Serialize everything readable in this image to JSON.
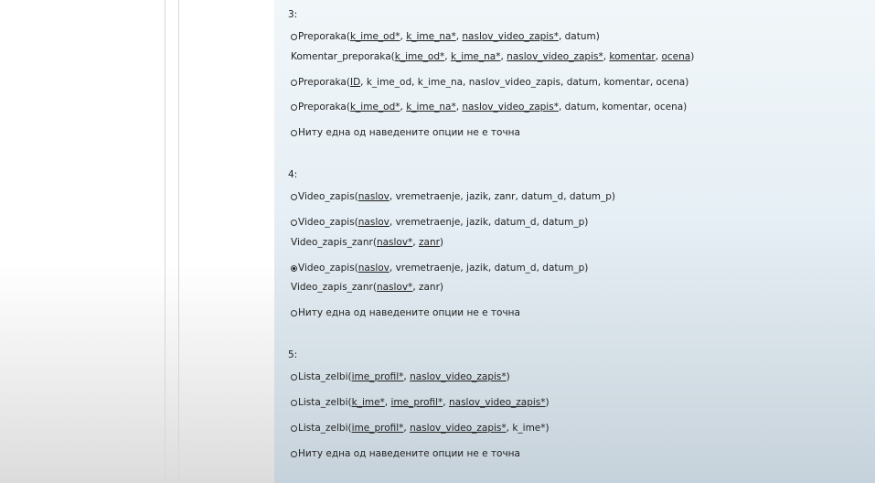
{
  "questions": [
    {
      "number": "3:",
      "options": [
        {
          "selected": false,
          "lines": [
            [
              "Preporaka(",
              {
                "u": "k_ime_od*"
              },
              ", ",
              {
                "u": "k_ime_na*"
              },
              ", ",
              {
                "u": "naslov_video_zapis*"
              },
              ", datum)"
            ],
            [
              "Komentar_preporaka(",
              {
                "u": "k_ime_od*"
              },
              ", ",
              {
                "u": "k_ime_na*"
              },
              ", ",
              {
                "u": "naslov_video_zapis*"
              },
              ", ",
              {
                "u": "komentar"
              },
              ", ",
              {
                "u": "ocena"
              },
              ")"
            ]
          ]
        },
        {
          "selected": false,
          "lines": [
            [
              "Preporaka(",
              {
                "u": "ID"
              },
              ", k_ime_od, k_ime_na, naslov_video_zapis, datum, komentar, ocena)"
            ]
          ]
        },
        {
          "selected": false,
          "lines": [
            [
              "Preporaka(",
              {
                "u": "k_ime_od*"
              },
              ", ",
              {
                "u": "k_ime_na*"
              },
              ", ",
              {
                "u": "naslov_video_zapis*"
              },
              ", datum, komentar, ocena)"
            ]
          ]
        },
        {
          "selected": false,
          "lines": [
            [
              "Ниту една од наведените опции не е точна"
            ]
          ]
        }
      ]
    },
    {
      "number": "4:",
      "options": [
        {
          "selected": false,
          "lines": [
            [
              "Video_zapis(",
              {
                "u": "naslov"
              },
              ", vremetraenje, jazik, zanr, datum_d, datum_p)"
            ]
          ]
        },
        {
          "selected": false,
          "lines": [
            [
              "Video_zapis(",
              {
                "u": "naslov"
              },
              ", vremetraenje, jazik, datum_d, datum_p)"
            ],
            [
              "Video_zapis_zanr(",
              {
                "u": "naslov*"
              },
              ", ",
              {
                "u": "zanr"
              },
              ")"
            ]
          ]
        },
        {
          "selected": true,
          "lines": [
            [
              "Video_zapis(",
              {
                "u": "naslov"
              },
              ", vremetraenje, jazik, datum_d, datum_p)"
            ],
            [
              "Video_zapis_zanr(",
              {
                "u": "naslov*"
              },
              ", zanr)"
            ]
          ]
        },
        {
          "selected": false,
          "lines": [
            [
              "Ниту една од наведените опции не е точна"
            ]
          ]
        }
      ]
    },
    {
      "number": "5:",
      "options": [
        {
          "selected": false,
          "lines": [
            [
              "Lista_zelbi(",
              {
                "u": "ime_profil*"
              },
              ", ",
              {
                "u": "naslov_video_zapis*"
              },
              ")"
            ]
          ]
        },
        {
          "selected": false,
          "lines": [
            [
              "Lista_zelbi(",
              {
                "u": "k_ime*"
              },
              ", ",
              {
                "u": "ime_profil*"
              },
              ", ",
              {
                "u": "naslov_video_zapis*"
              },
              ")"
            ]
          ]
        },
        {
          "selected": false,
          "lines": [
            [
              "Lista_zelbi(",
              {
                "u": "ime_profil*"
              },
              ", ",
              {
                "u": "naslov_video_zapis*"
              },
              ", k_ime*)"
            ]
          ]
        },
        {
          "selected": false,
          "lines": [
            [
              "Ниту една од наведените опции не е точна"
            ]
          ]
        }
      ]
    }
  ]
}
